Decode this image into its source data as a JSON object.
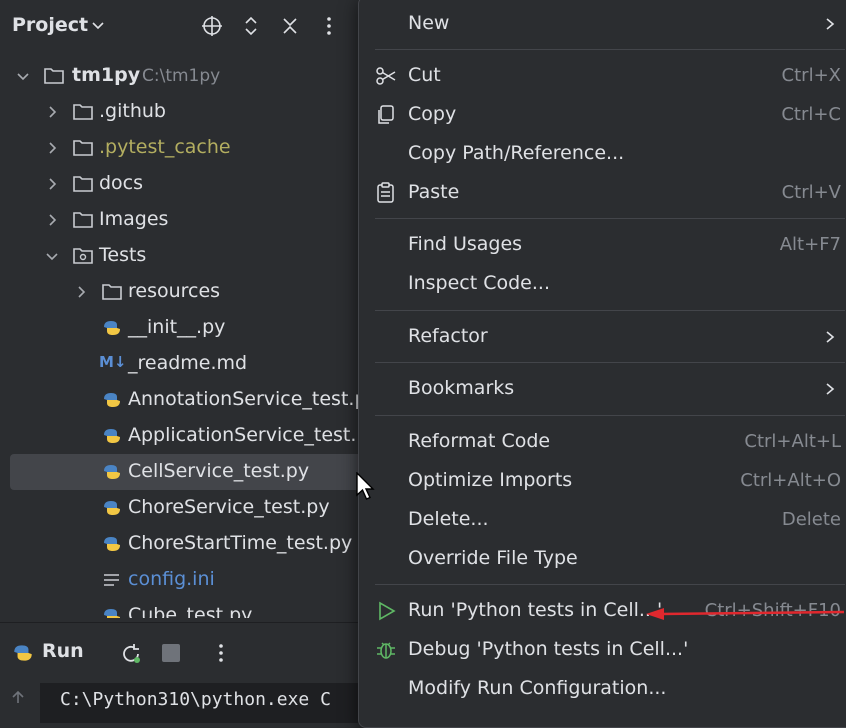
{
  "project": {
    "title": "Project",
    "tree": [
      {
        "label": "tm1py",
        "path": "C:\\tm1py"
      },
      {
        "label": ".github"
      },
      {
        "label": ".pytest_cache"
      },
      {
        "label": "docs"
      },
      {
        "label": "Images"
      },
      {
        "label": "Tests"
      },
      {
        "label": "resources"
      },
      {
        "label": "__init__.py"
      },
      {
        "label": "_readme.md",
        "badge": "M↓"
      },
      {
        "label": "AnnotationService_test.py"
      },
      {
        "label": "ApplicationService_test.py"
      },
      {
        "label": "CellService_test.py"
      },
      {
        "label": "ChoreService_test.py"
      },
      {
        "label": "ChoreStartTime_test.py"
      },
      {
        "label": "config.ini"
      },
      {
        "label": "Cube_test.py"
      }
    ]
  },
  "run": {
    "title": "Run",
    "console": "C:\\Python310\\python.exe C"
  },
  "menu": {
    "items": [
      {
        "label": "New",
        "shortcut": "",
        "icon": "none"
      },
      {
        "label": "Cut",
        "shortcut": "Ctrl+X",
        "icon": "scissors-icon"
      },
      {
        "label": "Copy",
        "shortcut": "Ctrl+C",
        "icon": "copy-icon"
      },
      {
        "label": "Copy Path/Reference...",
        "shortcut": "",
        "icon": "none"
      },
      {
        "label": "Paste",
        "shortcut": "Ctrl+V",
        "icon": "clipboard-icon"
      },
      {
        "label": "Find Usages",
        "shortcut": "Alt+F7",
        "icon": "none"
      },
      {
        "label": "Inspect Code...",
        "shortcut": "",
        "icon": "none"
      },
      {
        "label": "Refactor",
        "shortcut": "",
        "icon": "none"
      },
      {
        "label": "Bookmarks",
        "shortcut": "",
        "icon": "none"
      },
      {
        "label": "Reformat Code",
        "shortcut": "Ctrl+Alt+L",
        "icon": "none"
      },
      {
        "label": "Optimize Imports",
        "shortcut": "Ctrl+Alt+O",
        "icon": "none"
      },
      {
        "label": "Delete...",
        "shortcut": "Delete",
        "icon": "none"
      },
      {
        "label": "Override File Type",
        "shortcut": "",
        "icon": "none"
      },
      {
        "label": "Run 'Python tests in Cell...'",
        "shortcut": "Ctrl+Shift+F10",
        "icon": "run-icon"
      },
      {
        "label": "Debug 'Python tests in Cell...'",
        "shortcut": "",
        "icon": "debug-icon"
      },
      {
        "label": "Modify Run Configuration...",
        "shortcut": "",
        "icon": "none"
      }
    ]
  },
  "colors": {
    "background": "#2b2d30",
    "selection": "#43454a",
    "ignored_file": "#b3ae60",
    "config_file": "#5b8fd5",
    "run_green": "#5fb865",
    "annotation_red": "#e0282e"
  }
}
